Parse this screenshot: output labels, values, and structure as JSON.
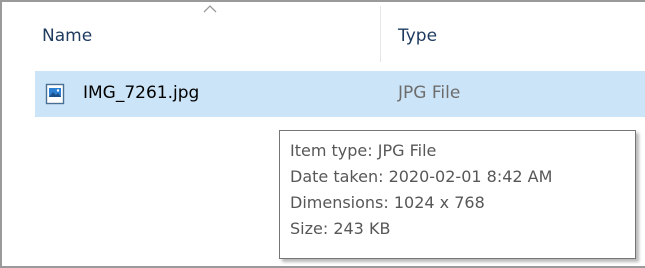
{
  "header": {
    "sort_indicator": "chevron-up-icon",
    "name_label": "Name",
    "type_label": "Type"
  },
  "files": [
    {
      "icon": "image-file-icon",
      "name": "IMG_7261.jpg",
      "type": "JPG File",
      "selected": true
    }
  ],
  "tooltip": {
    "item_type": "Item type: JPG File",
    "date_taken": "Date taken: 2020-02-01 8:42 AM",
    "dimensions": "Dimensions: 1024 x 768",
    "size": "Size: 243 KB"
  },
  "colors": {
    "selection": "#cce4f7",
    "header_text": "#1e3a5f",
    "muted_text": "#6d6d6d"
  }
}
